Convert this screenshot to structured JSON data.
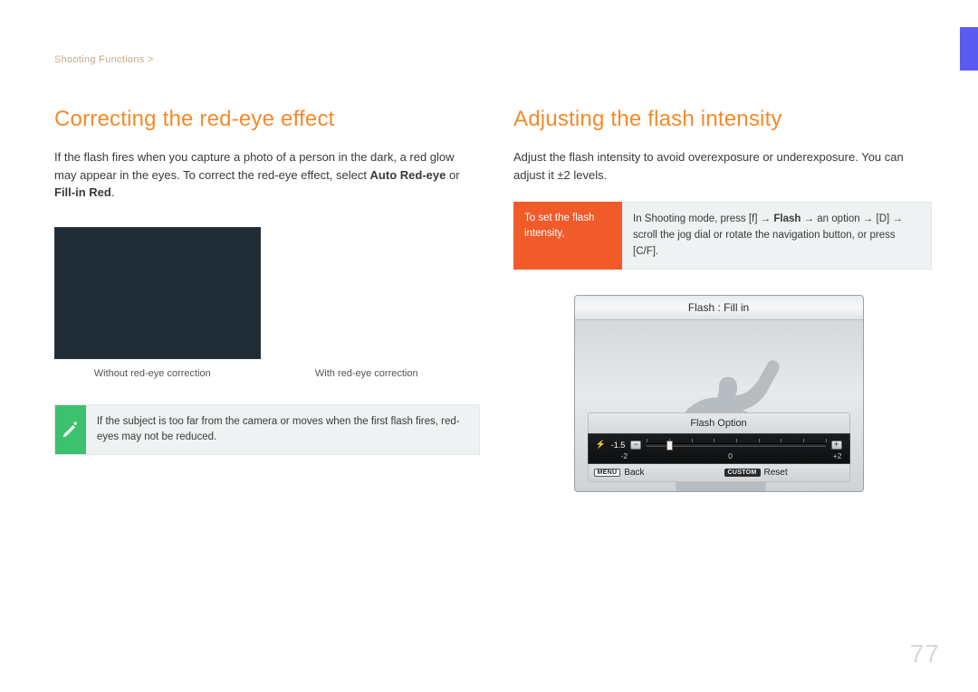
{
  "breadcrumb": "Shooting Functions >",
  "page_number": "77",
  "left": {
    "heading": "Correcting the red-eye effect",
    "para1": "If the flash fires when you capture a photo of a person in the dark, a red glow may appear in the eyes. To correct the red-eye effect, select ",
    "options_bold1": "Auto Red-eye",
    "options_mid": " or ",
    "options_bold2": "Fill-in Red",
    "options_end": ".",
    "caption_left": "Without red-eye correction",
    "caption_right": "With red-eye correction",
    "note": "If the subject is too far from the camera or moves when the first flash fires, red-eyes may not be reduced."
  },
  "right": {
    "heading": "Adjusting the flash intensity",
    "para1": "Adjust the flash intensity to avoid overexposure or underexposure. You can adjust it ±2 levels.",
    "instruction_label": "To set the flash intensity,",
    "instruction_pre": "In Shooting mode, press [f]     → ",
    "instruction_flash_bold": "Flash",
    "instruction_post": " → an option → [D]      → scroll the jog dial or rotate the navigation button, or press [C/F].",
    "lcd": {
      "title": "Flash : Fill in",
      "option_title": "Flash Option",
      "current_value": "-1.5",
      "labels": {
        "min": "-2",
        "mid": "0",
        "max": "+2"
      },
      "back_label": "Back",
      "reset_label": "Reset",
      "menu_badge": "MENU",
      "custom_badge": "CUSTOM"
    }
  }
}
